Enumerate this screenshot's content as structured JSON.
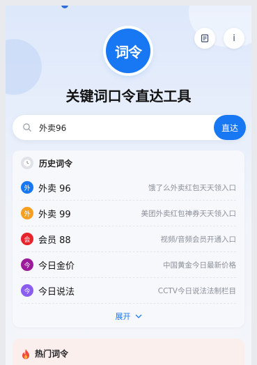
{
  "app": {
    "logo_text": "词令",
    "title": "关键词口令直达工具"
  },
  "search": {
    "value": "外卖96",
    "button_label": "直达"
  },
  "history": {
    "title": "历史词令",
    "items": [
      {
        "badge": "外",
        "badge_color": "#1877f2",
        "name": "外卖 96",
        "desc": "饿了么外卖红包天天领入口"
      },
      {
        "badge": "外",
        "badge_color": "#f5a020",
        "name": "外卖 99",
        "desc": "美团外卖红包神券天天领入口"
      },
      {
        "badge": "会",
        "badge_color": "#e8232b",
        "name": "会员 88",
        "desc": "视频/音频会员开通入口"
      },
      {
        "badge": "今",
        "badge_color": "#9b1b9b",
        "name": "今日金价",
        "desc": "中国黄金今日最新价格"
      },
      {
        "badge": "今",
        "badge_color": "#8a5cf0",
        "name": "今日说法",
        "desc": "CCTV今日说法法制栏目"
      }
    ],
    "expand_label": "展开"
  },
  "hot": {
    "title": "热门词令"
  },
  "colors": {
    "accent": "#1877f2"
  }
}
